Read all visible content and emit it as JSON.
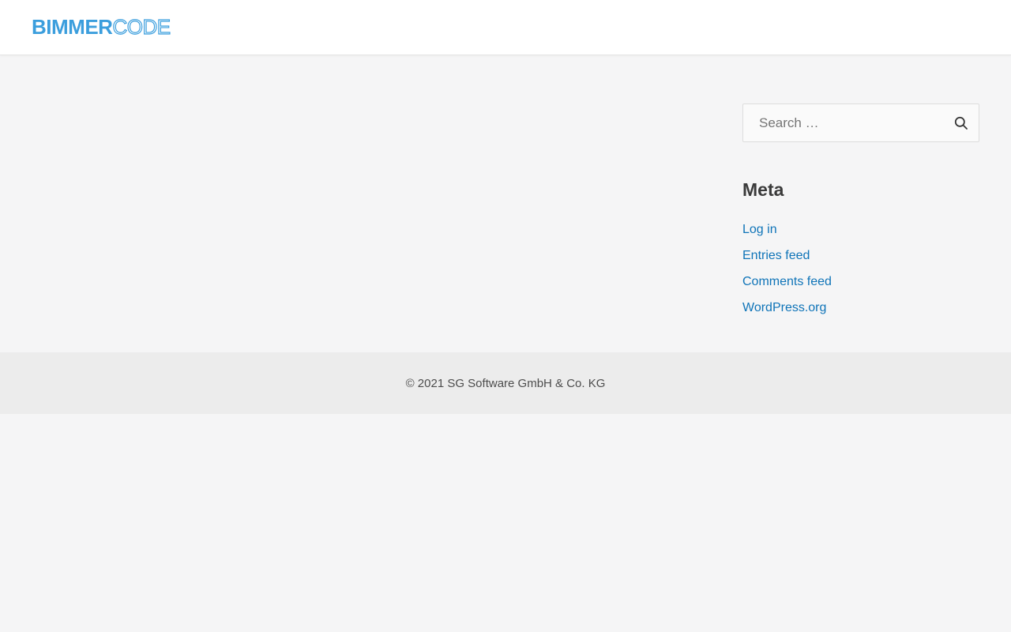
{
  "colors": {
    "brand_blue": "#3b9edd",
    "link_blue": "#0f74b8",
    "heading_text": "#3a3a3a",
    "body_text": "#4d4d4d",
    "header_bg": "#ffffff",
    "body_bg": "#f5f5f6",
    "footer_bg": "#ececec",
    "input_bg": "#fafafa",
    "input_border": "#dddddd",
    "placeholder_text": "#757575",
    "search_icon": "#333333"
  },
  "header": {
    "logo": {
      "text_bold": "BIMMER",
      "text_light": "CODE"
    }
  },
  "sidebar": {
    "search": {
      "placeholder": "Search …",
      "icon": "search-icon"
    },
    "meta": {
      "title": "Meta",
      "links": [
        {
          "label": "Log in"
        },
        {
          "label": "Entries feed"
        },
        {
          "label": "Comments feed"
        },
        {
          "label": "WordPress.org"
        }
      ]
    }
  },
  "footer": {
    "copyright": "© 2021 SG Software GmbH & Co. KG"
  }
}
